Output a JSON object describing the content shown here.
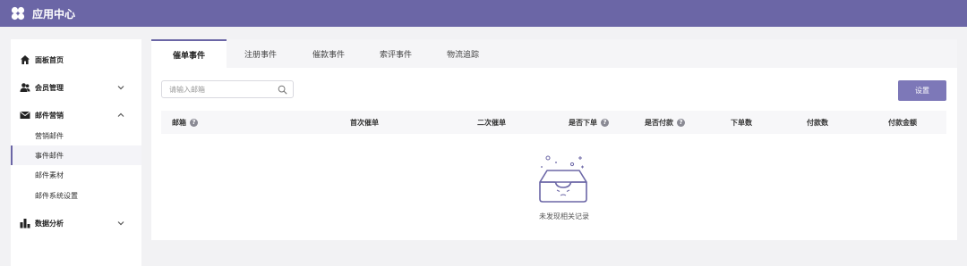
{
  "app": {
    "title": "应用中心",
    "logo_icon": "clover-logo-icon",
    "accent": "#6b66a6"
  },
  "sidebar": {
    "items": [
      {
        "label": "面板首页",
        "icon": "home-icon"
      },
      {
        "label": "会员管理",
        "icon": "members-icon",
        "expandable": true,
        "expanded": false
      },
      {
        "label": "邮件营销",
        "icon": "mail-icon",
        "expandable": true,
        "expanded": true,
        "children": [
          {
            "label": "营销邮件"
          },
          {
            "label": "事件邮件",
            "active": true
          },
          {
            "label": "邮件素材"
          },
          {
            "label": "邮件系统设置"
          }
        ]
      },
      {
        "label": "数据分析",
        "icon": "bar-chart-icon",
        "expandable": true,
        "expanded": false
      }
    ]
  },
  "tabs": [
    {
      "label": "催单事件",
      "active": true
    },
    {
      "label": "注册事件"
    },
    {
      "label": "催款事件"
    },
    {
      "label": "索评事件"
    },
    {
      "label": "物流追踪"
    }
  ],
  "search": {
    "placeholder": "请输入邮箱",
    "value": ""
  },
  "buttons": {
    "settings": "设置"
  },
  "table": {
    "columns": [
      {
        "label": "邮箱",
        "help": true
      },
      {
        "label": "首次催单"
      },
      {
        "label": "二次催单"
      },
      {
        "label": "是否下单",
        "help": true
      },
      {
        "label": "是否付款",
        "help": true
      },
      {
        "label": "下单数"
      },
      {
        "label": "付款数"
      },
      {
        "label": "付款金额"
      }
    ],
    "rows": [],
    "empty_text": "未发现相关记录"
  }
}
